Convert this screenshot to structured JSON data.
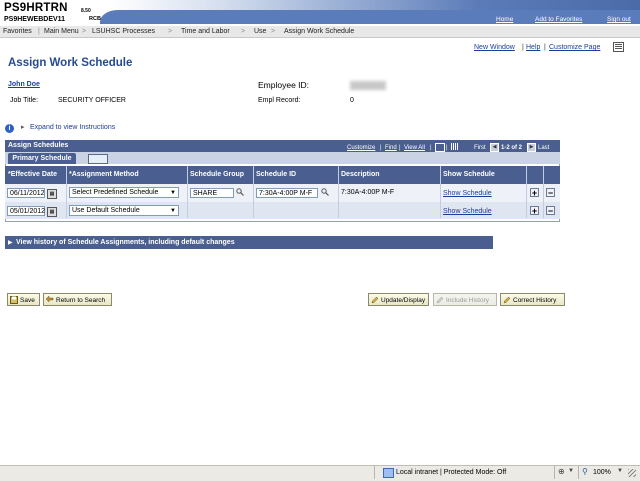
{
  "header": {
    "system_title": "PS9HRTRN",
    "system_version": "8.50",
    "database": "PS9HEWEBDEV11",
    "user": "RCB",
    "links": [
      "Home",
      "Add to Favorites",
      "Sign out"
    ]
  },
  "breadcrumb": [
    "Favorites",
    "Main Menu",
    "LSUHSC Processes",
    "Time and Labor",
    "Use",
    "Assign Work Schedule"
  ],
  "page_links": [
    "New Window",
    "Help",
    "Customize Page"
  ],
  "page_title": "Assign Work Schedule",
  "employee": {
    "name": "John Doe",
    "job_title_label": "Job Title:",
    "job_title": "SECURITY OFFICER",
    "employee_id_label": "Employee ID:",
    "empl_record_label": "Empl Record:",
    "empl_record": "0"
  },
  "instructions_link": "Expand to view Instructions",
  "grid": {
    "title": "Assign Schedules",
    "nav": {
      "customize": "Customize",
      "find": "Find",
      "view_all": "View All",
      "first": "First",
      "range": "1-2 of 2",
      "last": "Last"
    },
    "tab": "Primary Schedule",
    "columns": [
      "*Effective Date",
      "*Assignment Method",
      "Schedule Group",
      "Schedule ID",
      "Description",
      "Show Schedule"
    ],
    "rows": [
      {
        "effective_date": "06/11/2012",
        "assignment_method": "Select Predefined Schedule",
        "schedule_group": "SHARE",
        "schedule_id": "7:30A-4:00P M-F",
        "description": "7:30A-4:00P M-F",
        "show_schedule": "Show Schedule"
      },
      {
        "effective_date": "05/01/2012",
        "assignment_method": "Use Default Schedule",
        "schedule_group": "",
        "schedule_id": "",
        "description": "",
        "show_schedule": "Show Schedule"
      }
    ]
  },
  "history_bar": "View history of Schedule Assignments, including default changes",
  "buttons": {
    "save": "Save",
    "return_to_search": "Return to Search",
    "update_display": "Update/Display",
    "include_history": "Include History",
    "correct_history": "Correct History"
  },
  "status_bar": {
    "zone": "Local intranet | Protected Mode: Off",
    "zoom": "100%"
  },
  "colors": {
    "accent": "#4a5f8f",
    "link": "#1c3e94",
    "title": "#274a8f"
  }
}
